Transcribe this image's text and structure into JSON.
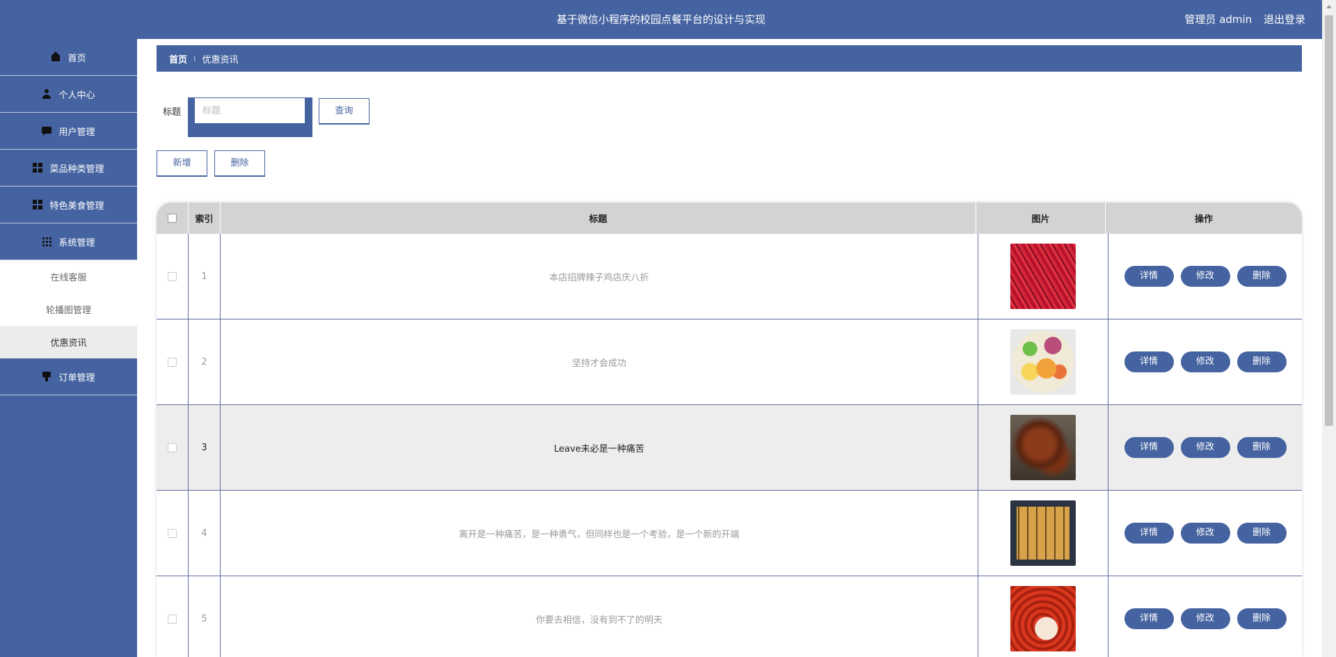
{
  "header": {
    "title": "基于微信小程序的校园点餐平台的设计与实现",
    "user": "管理员 admin",
    "logout": "退出登录"
  },
  "sidebar": {
    "items": [
      {
        "label": "首页",
        "icon": "home-icon"
      },
      {
        "label": "个人中心",
        "icon": "user-icon"
      },
      {
        "label": "用户管理",
        "icon": "chat-icon"
      },
      {
        "label": "菜品种类管理",
        "icon": "grid-icon"
      },
      {
        "label": "特色美食管理",
        "icon": "grid-icon"
      },
      {
        "label": "系统管理",
        "icon": "apps-icon"
      }
    ],
    "sub_items": [
      {
        "label": "在线客服"
      },
      {
        "label": "轮播图管理"
      },
      {
        "label": "优惠资讯",
        "active": true
      }
    ],
    "order_item": {
      "label": "订单管理",
      "icon": "order-icon"
    }
  },
  "breadcrumb": {
    "home": "首页",
    "separator": "⁝",
    "current": "优惠资讯"
  },
  "search": {
    "label": "标题",
    "placeholder": "标题",
    "query_button": "查询"
  },
  "toolbar": {
    "add_label": "新增",
    "delete_label": "删除"
  },
  "table": {
    "columns": [
      "索引",
      "标题",
      "图片",
      "操作"
    ],
    "rows": [
      {
        "index": "1",
        "title": "本店招牌辣子鸡店庆八折"
      },
      {
        "index": "2",
        "title": "坚持才会成功"
      },
      {
        "index": "3",
        "title": "Leave未必是一种痛苦"
      },
      {
        "index": "4",
        "title": "离开是一种痛苦，是一种勇气，但同样也是一个考验，是一个新的开端"
      },
      {
        "index": "5",
        "title": "你要去相信，没有到不了的明天"
      }
    ],
    "actions": {
      "detail": "详情",
      "edit": "修改",
      "delete": "删除"
    }
  },
  "colors": {
    "primary": "#4563a0",
    "header_row": "#d3d3d3",
    "highlight_row": "#ededed"
  }
}
